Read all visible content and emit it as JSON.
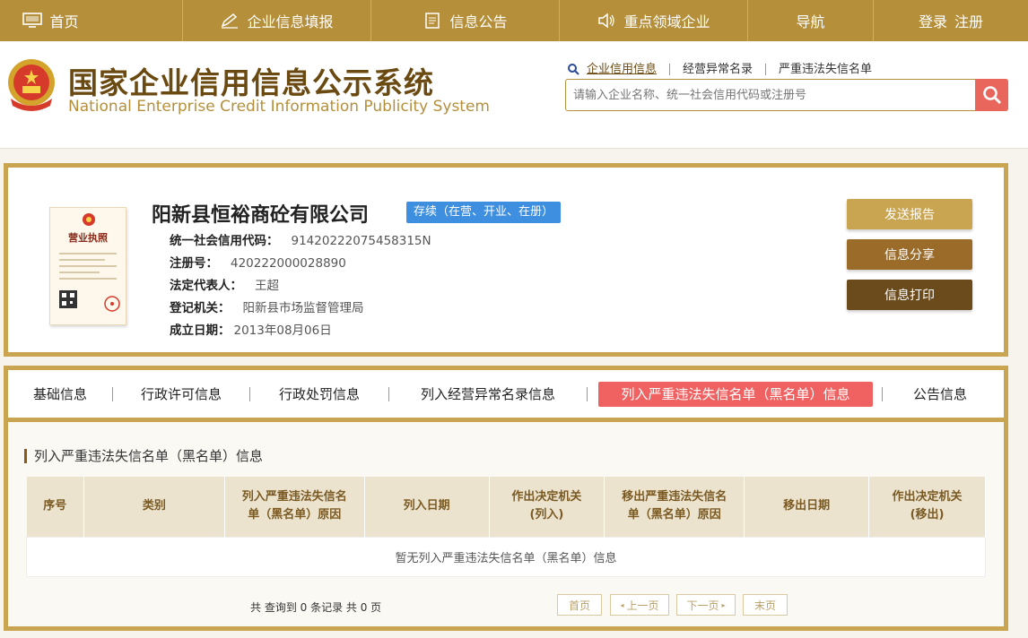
{
  "topnav": {
    "items": [
      {
        "label": "首页",
        "icon": "monitor-icon"
      },
      {
        "label": "企业信息填报",
        "icon": "pen-icon"
      },
      {
        "label": "信息公告",
        "icon": "document-icon"
      },
      {
        "label": "重点领域企业",
        "icon": "speaker-icon"
      },
      {
        "label": "导航",
        "icon": ""
      },
      {
        "label": "登录",
        "icon": ""
      }
    ],
    "register_label": "注册"
  },
  "header": {
    "title_cn": "国家企业信用信息公示系统",
    "title_en": "National Enterprise Credit Information Publicity System",
    "search_tabs": [
      "企业信用信息",
      "经营异常名录",
      "严重违法失信名单"
    ],
    "search_placeholder": "请输入企业名称、统一社会信用代码或注册号"
  },
  "company": {
    "name": "阳新县恒裕商砼有限公司",
    "status": "存续（在营、开业、在册）",
    "license_caption": "营业执照",
    "fields": [
      {
        "label": "统一社会信用代码：",
        "value": "91420222075458315N"
      },
      {
        "label": "注册号：",
        "value": "420222000028890"
      },
      {
        "label": "法定代表人：",
        "value": "王超"
      },
      {
        "label": "登记机关：",
        "value": "阳新县市场监督管理局"
      },
      {
        "label": "成立日期：",
        "value": "2013年08月06日"
      }
    ],
    "actions": [
      "发送报告",
      "信息分享",
      "信息打印"
    ]
  },
  "details": {
    "tabs": [
      "基础信息",
      "行政许可信息",
      "行政处罚信息",
      "列入经营异常名录信息",
      "列入严重违法失信名单（黑名单）信息",
      "公告信息"
    ],
    "active_tab": 4,
    "section_title": "列入严重违法失信名单（黑名单）信息",
    "columns": [
      [
        "序号"
      ],
      [
        "类别"
      ],
      [
        "列入严重违法失信名",
        "单（黑名单）原因"
      ],
      [
        "列入日期"
      ],
      [
        "作出决定机关",
        "(列入)"
      ],
      [
        "移出严重违法失信名",
        "单（黑名单）原因"
      ],
      [
        "移出日期"
      ],
      [
        "作出决定机关",
        "(移出)"
      ]
    ],
    "empty_message": "暂无列入严重违法失信名单（黑名单）信息",
    "pager": {
      "summary": "共 查询到 0 条记录 共 0 页",
      "first": "首页",
      "prev": "上一页",
      "next": "下一页",
      "last": "末页"
    }
  },
  "colors": {
    "gold": "#b58f3a",
    "active_tab": "#f06262",
    "badge": "#3f8fe0"
  }
}
